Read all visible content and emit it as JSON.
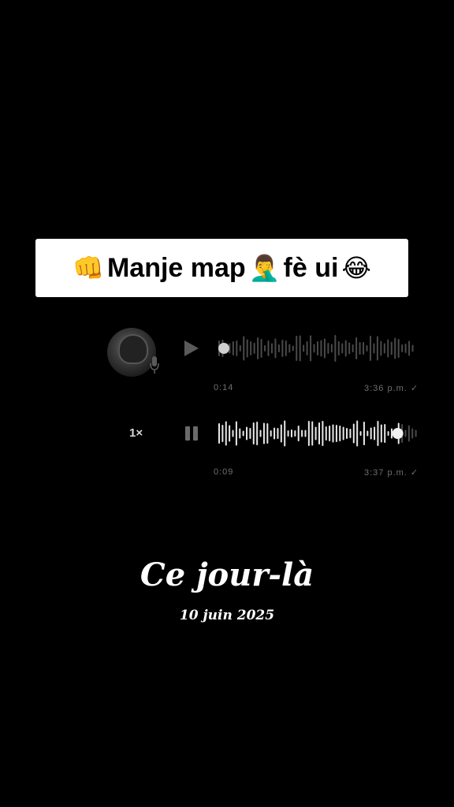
{
  "caption": {
    "emoji_fist": "👊",
    "text_1": "Manje map",
    "emoji_facepalm": "🤦‍♂️",
    "text_2": "fè ui",
    "emoji_laugh": "😂"
  },
  "voice_messages": [
    {
      "duration": "0:14",
      "time": "3:36 p.m.",
      "status": "✓",
      "state": "paused",
      "progress": 0.0
    },
    {
      "speed": "1×",
      "duration": "0:09",
      "time": "3:37 p.m.",
      "status": "✓",
      "state": "playing",
      "progress": 0.9
    }
  ],
  "footer": {
    "title": "Ce jour-là",
    "date": "10 juin 2025"
  },
  "colors": {
    "background": "#000000",
    "caption_bg": "#ffffff",
    "wave_dim": "#4a4a4a",
    "wave_bright": "#e8e8e8",
    "meta_text": "#6f6f6f"
  },
  "icons": [
    "fist-emoji",
    "facepalm-emoji",
    "laugh-emoji",
    "play-icon",
    "pause-icon",
    "mic-icon",
    "checkmark-icon"
  ]
}
